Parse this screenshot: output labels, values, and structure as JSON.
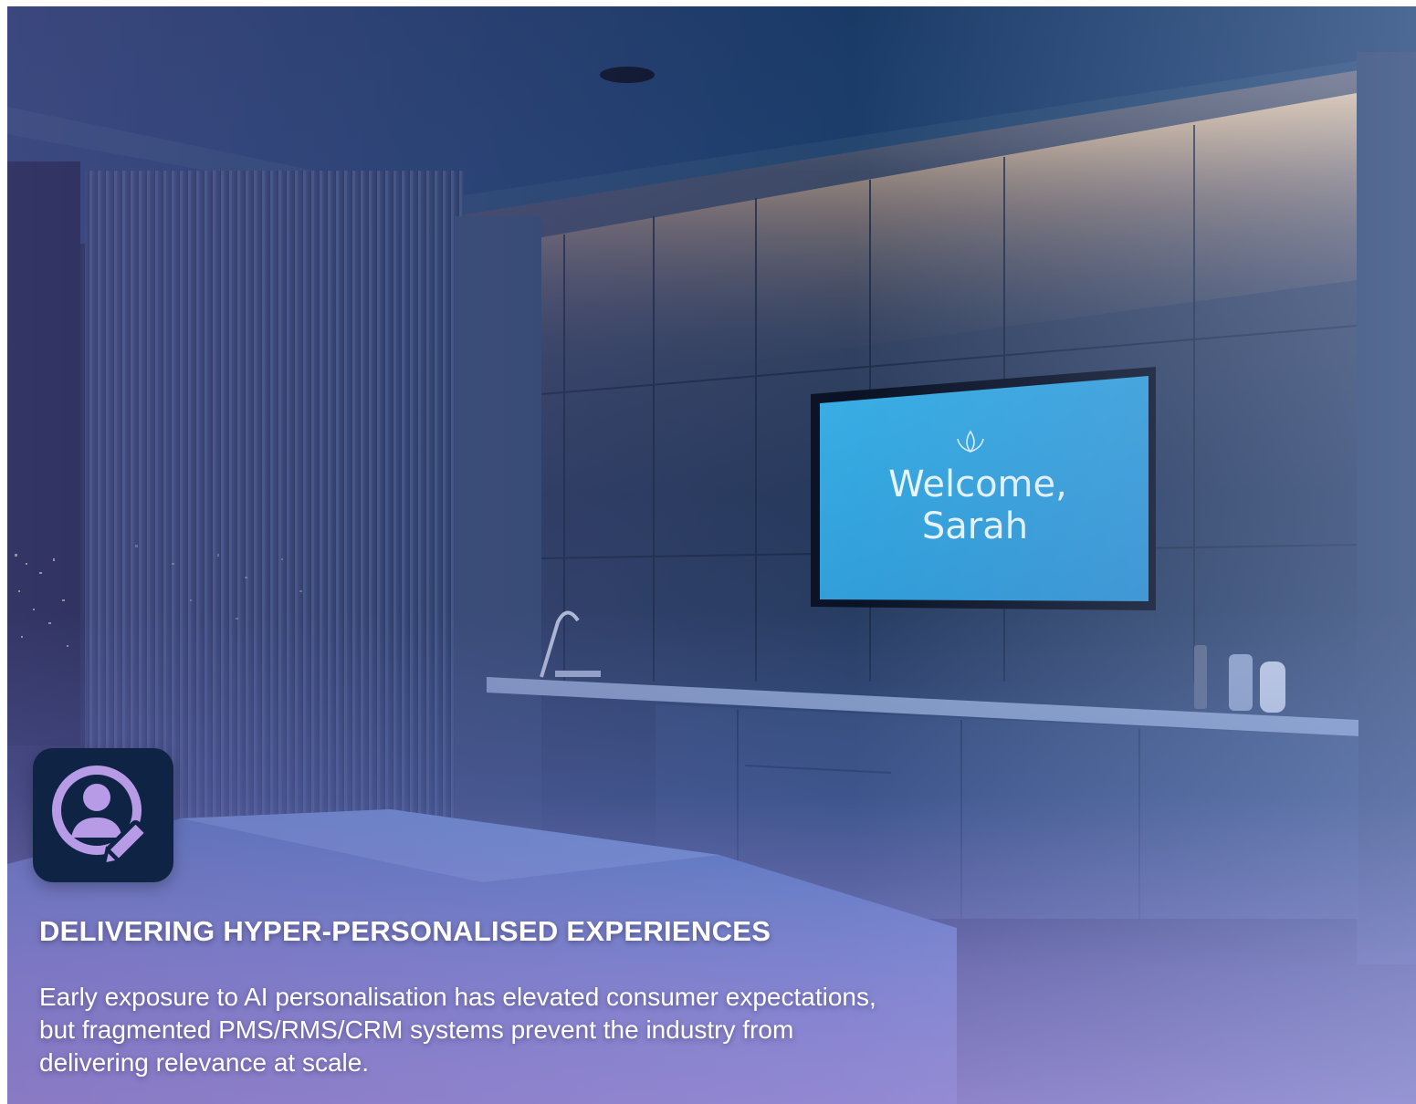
{
  "scene": {
    "tv_greeting_line1": "Welcome,",
    "tv_greeting_line2": "Sarah"
  },
  "card": {
    "title": "DELIVERING HYPER-PERSONALISED EXPERIENCES",
    "body": "Early exposure to AI personalisation has elevated consumer expectations, but fragmented PMS/RMS/CRM systems prevent the industry from delivering relevance at scale."
  },
  "icons": {
    "badge": "user-edit-icon"
  },
  "colors": {
    "badge_bg": "#0f2344",
    "icon_accent": "#b79be6",
    "tv_screen": "#2fa6dc",
    "headline": "#ffffff"
  }
}
